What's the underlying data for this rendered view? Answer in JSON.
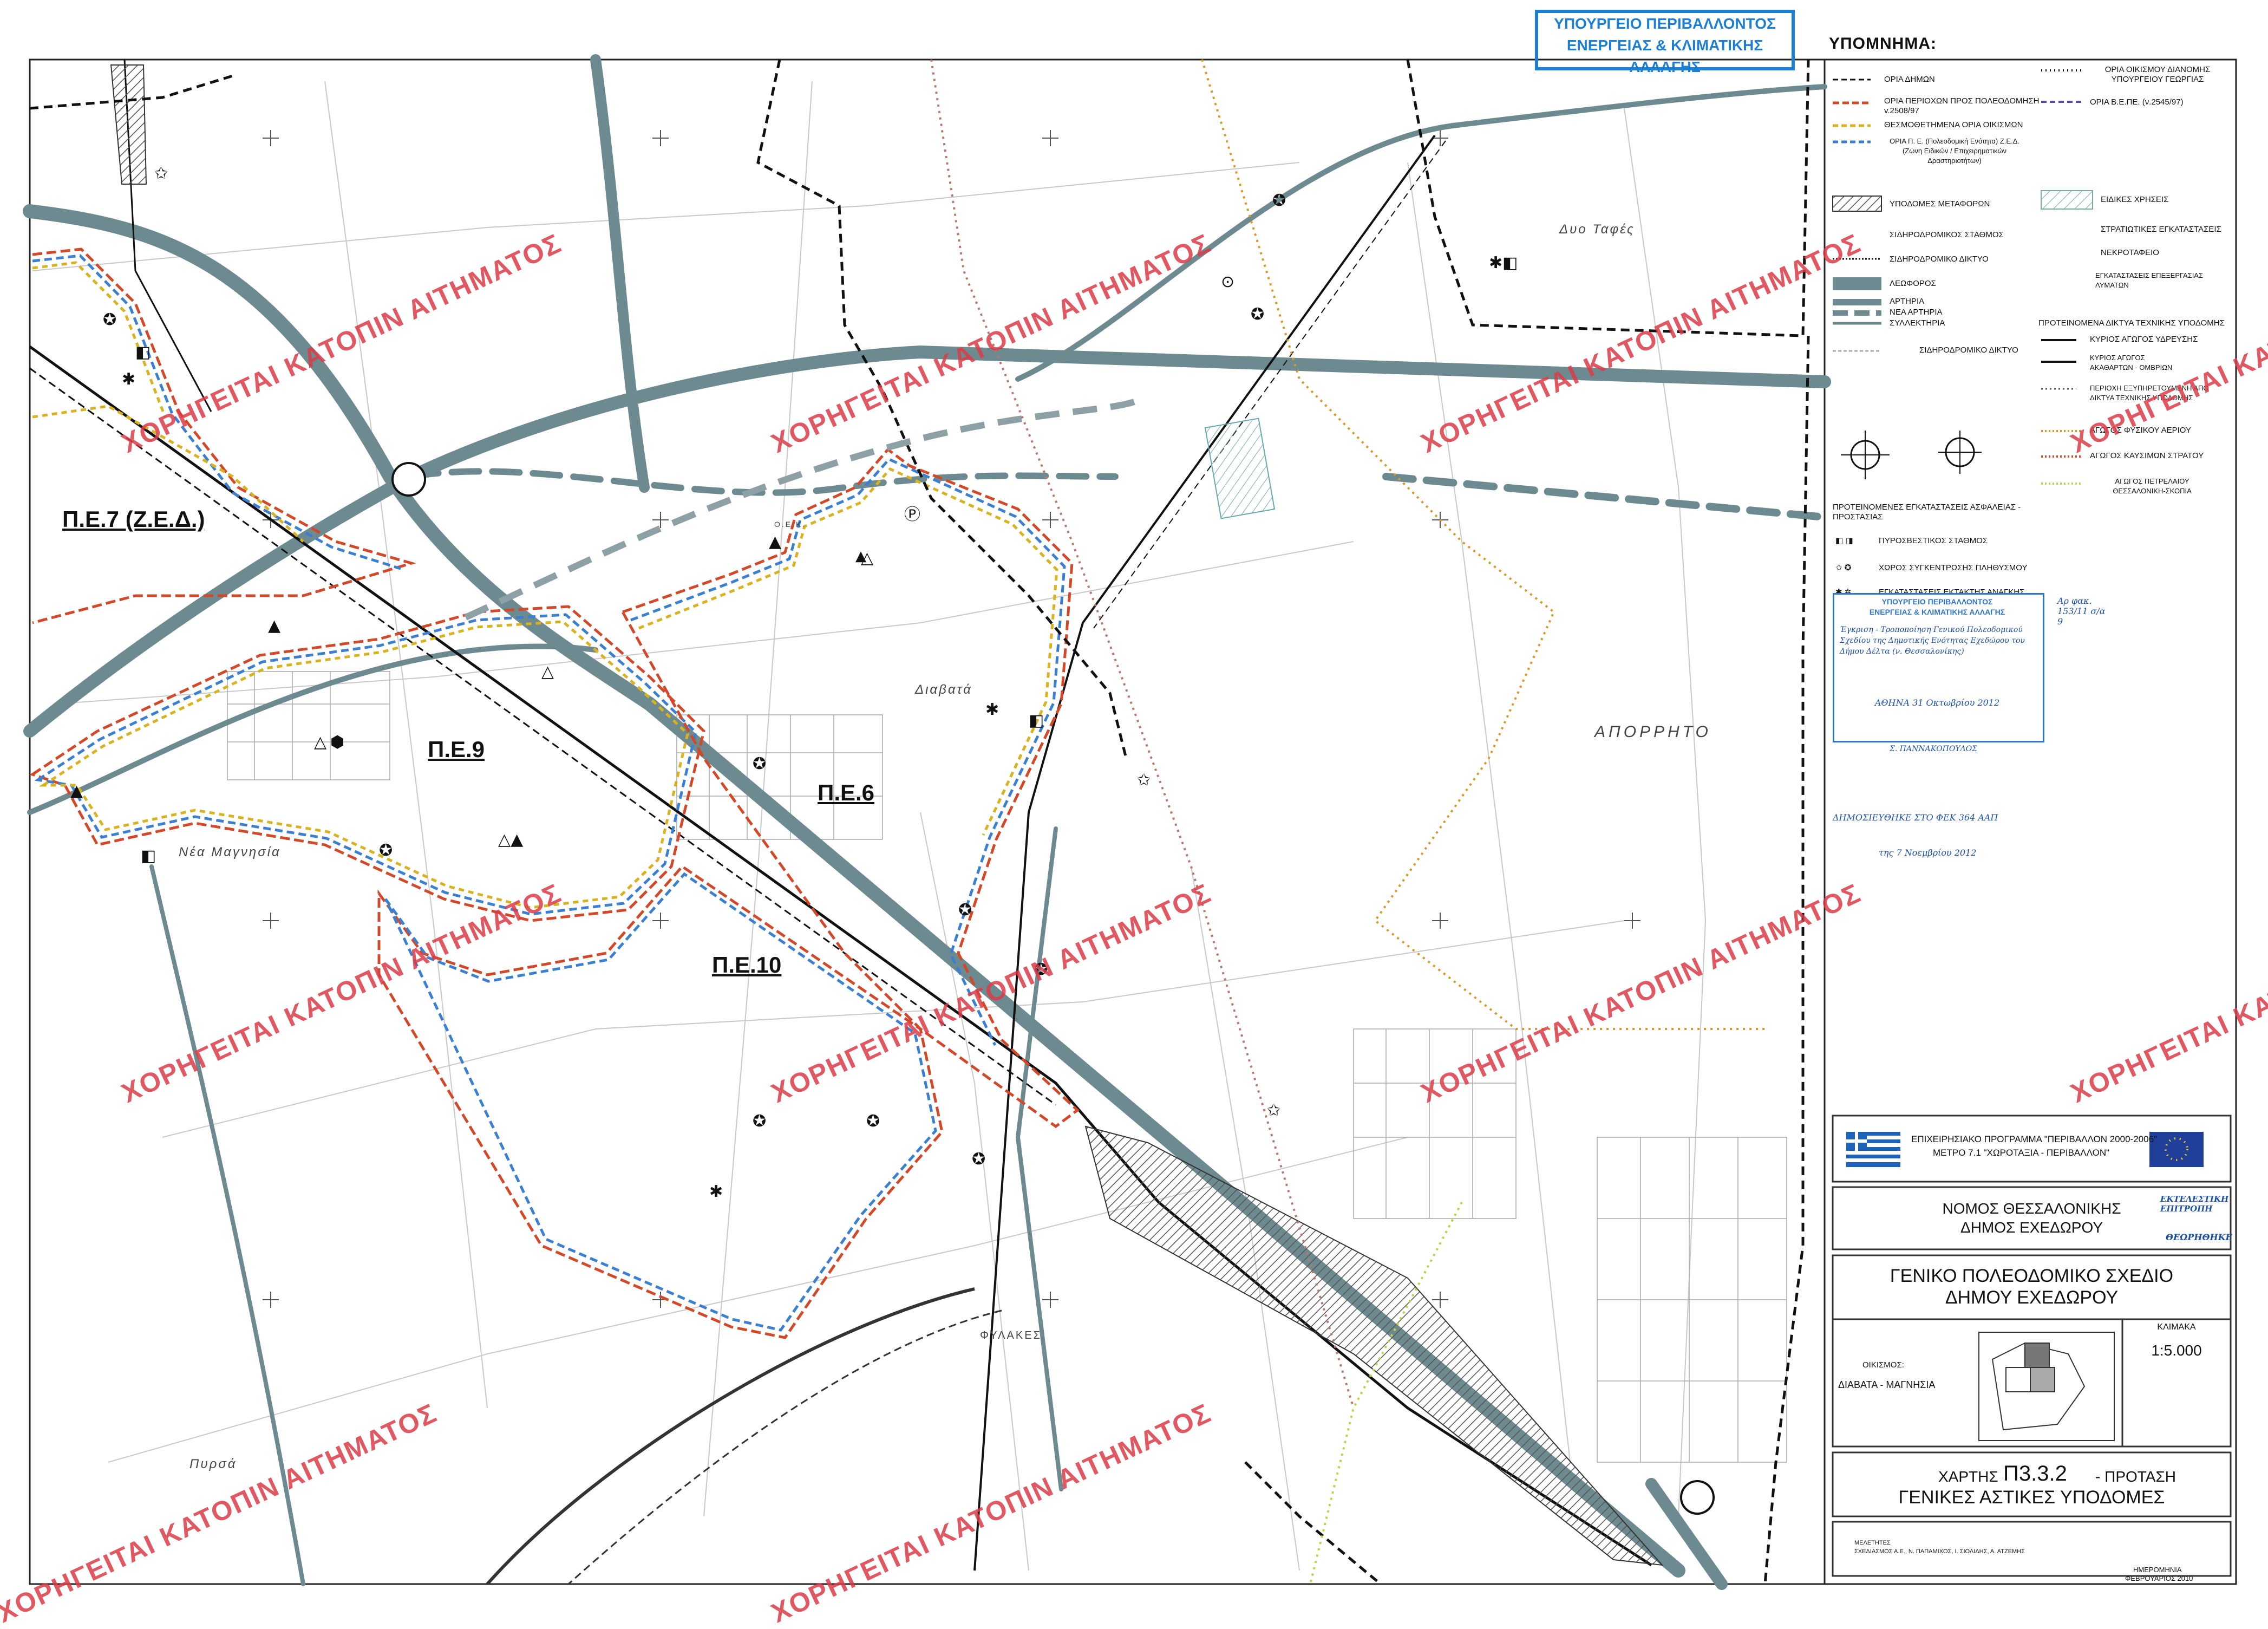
{
  "stamp_top": {
    "line1": "ΥΠΟΥΡΓΕΙΟ ΠΕΡΙΒΑΛΛΟΝΤΟΣ",
    "line2": "ΕΝΕΡΓΕΙΑΣ & ΚΛΙΜΑΤΙΚΗΣ ΑΛΛΑΓΗΣ"
  },
  "legend": {
    "title": "ΥΠΟΜΝΗΜΑ:",
    "col1": [
      {
        "label": "ΟΡΙΑ ΔΗΜΩΝ",
        "sym": "black-dash"
      },
      {
        "label": "ΟΡΙΑ ΠΕΡΙΟΧΩΝ ΠΡΟΣ ΠΟΛΕΟΔΟΜΗΣΗ v.2508/97",
        "sym": "red-dash"
      },
      {
        "label": "ΘΕΣΜΟΘΕΤΗΜΕΝΑ ΟΡΙΑ ΟΙΚΙΣΜΩΝ",
        "sym": "yellow-dash"
      },
      {
        "label": "ΟΡΙΑ Π. Ε. (Πολεοδομική Ενότητα) Ζ.Ε.Δ. (Ζώνη Ειδικών / Επιχειρηματικών Δραστηριοτήτων)",
        "sym": "blue-dash"
      },
      {
        "label": "ΥΠΟΔΟΜΕΣ ΜΕΤΑΦΟΡΩΝ",
        "sym": "hatch-box"
      },
      {
        "label": "ΣΙΔΗΡΟΔΡΟΜΙΚΟΣ ΣΤΑΘΜΟΣ",
        "sym": "station"
      },
      {
        "label": "ΣΙΔΗΡΟΔΡΟΜΙΚΟ ΔΙΚΤΥΟ",
        "sym": "rail"
      },
      {
        "label": "ΛΕΩΦΟΡΟΣ",
        "sym": "thick"
      },
      {
        "label": "ΑΡΤΗΡΙΑ",
        "sym": "medium"
      },
      {
        "label": "ΝΕΑ ΑΡΤΗΡΙΑ",
        "sym": "dashed-medium"
      },
      {
        "label": "ΣΥΛΛΕΚΤΗΡΙΑ",
        "sym": "thin"
      },
      {
        "label": "ΣΙΔΗΡΟΔΡΟΜΙΚΟ ΔΙΚΤΥΟ",
        "sym": "light-rail"
      }
    ],
    "col2": [
      {
        "label": "ΟΡΙΑ ΟΙΚΙΣΜΟΥ ΔΙΑΝΟΜΗΣ ΥΠΟΥΡΓΕΙΟΥ ΓΕΩΡΓΙΑΣ",
        "sym": "dot-dash"
      },
      {
        "label": "ΟΡΙΑ Β.Ε.ΠΕ. (ν.2545/97)",
        "sym": "purple-dash"
      },
      {
        "label": "ΕΙΔΙΚΕΣ ΧΡΗΣΕΙΣ",
        "sym": "grey-hatch"
      },
      {
        "label": "ΣΤΡΑΤΙΩΤΙΚΕΣ ΕΓΚΑΤΑΣΤΑΣΕΙΣ",
        "sym": "circle"
      },
      {
        "label": "ΝΕΚΡΟΤΑΦΕΙΟ",
        "sym": "circle"
      },
      {
        "label": "ΕΓΚΑΤΑΣΤΑΣΕΙΣ ΕΠΕΞΕΡΓΑΣΙΑΣ ΛΥΜΑΤΩΝ",
        "sym": "circle"
      },
      {
        "label": "ΠΡΟΤΕΙΝΟΜΕΝΑ ΔΙΚΤΥΑ ΤΕΧΝΙΚΗΣ ΥΠΟΔΟΜΗΣ",
        "sym": "none"
      },
      {
        "label": "ΚΥΡΙΟΣ ΑΓΩΓΟΣ ΥΔΡΕΥΣΗΣ",
        "sym": "pipe"
      },
      {
        "label": "ΚΥΡΙΟΣ ΑΓΩΓΟΣ ΑΚΑΘΑΡΤΩΝ - ΟΜΒΡΙΩΝ",
        "sym": "pipe"
      },
      {
        "label": "ΠΕΡΙΟΧΗ ΕΞΥΠΗΡΕΤΟΥΜΕΝΗ ΑΠΟ ΔΙΚΤΥΑ ΤΕΧΝΙΚΗΣ ΥΠΟΔΟΜΗΣ",
        "sym": "circles"
      },
      {
        "label": "ΑΓΩΓΟΣ ΦΥΣΙΚΟΥ ΑΕΡΙΟΥ",
        "sym": "orange-dot"
      },
      {
        "label": "ΑΓΩΓΟΣ ΚΑΥΣΙΜΩΝ ΣΤΡΑΤΟΥ",
        "sym": "red-dot"
      },
      {
        "label": "ΑΓΩΓΟΣ ΠΕΤΡΕΛΑΙΟΥ ΘΕΣΣΑΛΟΝΙΚΗ-ΣΚΟΠΙΑ",
        "sym": "green-dot"
      }
    ],
    "safety_title": "ΠΡΟΤΕΙΝΟΜΕΝΕΣ ΕΓΚΑΤΑΣΤΑΣΕΙΣ ΑΣΦΑΛΕΙΑΣ - ΠΡΟΣΤΑΣΙΑΣ",
    "safety": [
      "ΠΥΡΟΣΒΕΣΤΙΚΟΣ ΣΤΑΘΜΟΣ",
      "ΧΩΡΟΣ ΣΥΓΚΕΝΤΡΩΣΗΣ ΠΛΗΘΥΣΜΟΥ",
      "ΕΓΚΑΤΑΣΤΑΣΕΙΣ ΕΚΤΑΚΤΗΣ ΑΝΑΓΚΗΣ"
    ]
  },
  "stamp_mid": {
    "line1": "ΥΠΟΥΡΓΕΙΟ ΠΕΡΙΒΑΛΛΟΝΤΟΣ",
    "line2": "ΕΝΕΡΓΕΙΑΣ & ΚΛΙΜΑΤΙΚΗΣ ΑΛΛΑΓΗΣ",
    "note": "Αρ φακ. 153/11 σ/α 9",
    "hand1": "Έγκριση - Τροποποίηση Γενικού Πολεοδομικού Σχεδίου της Δημοτικής Ενότητας Εχεδώρου του Δήμου Δέλτα (ν. Θεσσαλονίκης)",
    "hand2": "ΑΘΗΝΑ 31 Οκτωβρίου 2012",
    "sign": "Σ. ΠΑΝΝΑΚΟΠΟΥΛΟΣ"
  },
  "blue_note": {
    "line1": "ΔΗΜΟΣΙΕΥΘΗΚΕ ΣΤΟ ΦΕΚ 364 ΑΑΠ",
    "line2": "της 7 Νοεμβρίου 2012"
  },
  "zones": [
    "Π.Ε.7 (Ζ.Ε.Δ.)",
    "Π.Ε.9",
    "Π.Ε.6",
    "Π.Ε.10"
  ],
  "places": {
    "nea_magnisia": "Νέα Μαγνησία",
    "diavata": "Διαβατά",
    "dyo_tafes": "Δυο Ταφές",
    "aporrito": "ΑΠΟΡΡΗΤΟ",
    "fylakes": "ΦΥΛΑΚΕΣ",
    "pyrsa": "Πυρσά",
    "oek": "Ο.Ε.Κ."
  },
  "watermark": "ΧΟΡΗΓΕΙΤΑΙ ΚΑΤΟΠΙΝ ΑΙΤΗΜΑΤΟΣ",
  "title_block": {
    "program": "ΕΠΙΧΕΙΡΗΣΙΑΚΟ ΠΡΟΓΡΑΜΜΑ \"ΠΕΡΙΒΑΛΛΟΝ 2000-2006\"",
    "measure": "ΜΕΤΡΟ 7.1 \"ΧΩΡΟΤΑΞΙΑ - ΠΕΡΙΒΑΛΛΟΝ\"",
    "prefecture": "ΝΟΜΟΣ ΘΕΣΣΑΛΟΝΙΚΗΣ",
    "municipality": "ΔΗΜΟΣ ΕΧΕΔΩΡΟΥ",
    "plan1": "ΓΕΝΙΚΟ ΠΟΛΕΟΔΟΜΙΚΟ ΣΧΕΔΙΟ",
    "plan2": "ΔΗΜΟΥ ΕΧΕΔΩΡΟΥ",
    "scale_label": "ΚΛΙΜΑΚΑ",
    "scale": "1:5.000",
    "settlement_label": "ΟΙΚΙΣΜΟΣ:",
    "settlement": "ΔΙΑΒΑΤΑ - ΜΑΓΝΗΣΙΑ",
    "map_label": "ΧΑΡΤΗΣ",
    "map_code": "Π3.3.2",
    "map_kind": "- ΠΡΟΤΑΣΗ",
    "map_title": "ΓΕΝΙΚΕΣ ΑΣΤΙΚΕΣ ΥΠΟΔΟΜΕΣ",
    "authors_label": "ΜΕΛΕΤΗΤΕΣ",
    "authors": "ΣΧΕΔΙΑΣΜΟΣ Α.Ε., Ν. ΠΑΠΑΜΙΧΟΣ, Ι. ΣΙΟΛΙΔΗΣ, Α. ΑΤΖΕΜΗΣ",
    "date_label": "ΗΜΕΡΟΜΗΝΙΑ",
    "date": "ΦΕΒΡΟΥΑΡΙΟΣ 2010",
    "committee": "ΕΚΤΕΛΕΣΤΙΚΗ ΕΠΙΤΡΟΠΗ",
    "approved": "ΘΕΩΡΗΘΗΚΕ"
  },
  "colors": {
    "road": "#6d8a90",
    "border_red": "#d2492a",
    "border_blue": "#3b7fd1",
    "border_yellow": "#d9b21f",
    "watermark": "#db3c46",
    "stamp_blue": "#1c7fd4"
  },
  "icons": [
    "fire-station-icon",
    "assembly-point-icon",
    "emergency-facility-icon",
    "roundabout-icon",
    "flag-greece-icon",
    "flag-eu-icon"
  ]
}
